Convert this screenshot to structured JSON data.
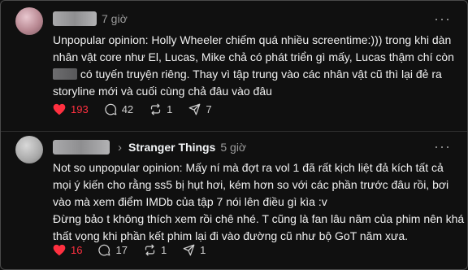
{
  "posts": [
    {
      "time": "7 giờ",
      "more": "···",
      "lines": [
        "Unpopular opinion: Holly Wheeler chiếm quá nhiều screentime:))) trong khi dàn",
        "nhân vật core như El, Lucas, Mike chả có phát triển gì mấy, Lucas thậm chí còn",
        "có tuyến truyện riêng. Thay vì tập trung vào các nhân vật cũ thì lại đẻ ra",
        "storyline mới và cuối cùng chả đâu vào đâu"
      ],
      "likes": "193",
      "comments": "42",
      "reposts": "1",
      "shares": "7"
    },
    {
      "community": "Stranger Things",
      "time": "5 giờ",
      "more": "···",
      "lines": [
        "Not so unpopular opinion: Mấy ní mà đợt ra vol 1 đã rất kịch liệt đả kích tất cả",
        "mọi ý kiến cho rằng ss5 bị hụt hơi, kém hơn so với các phần trước đâu rồi, bơi",
        "vào mà xem điểm IMDb của tập 7 nói lên điều gì kìa :v",
        "Đừng bảo t không thích xem rồi chê nhé. T cũng là fan lâu năm của phim nên khá",
        "thất vọng khi phần kết phim lại đi vào đường cũ như bộ GoT năm xưa."
      ],
      "likes": "16",
      "comments": "17",
      "reposts": "1",
      "shares": "1"
    }
  ],
  "colors": {
    "like": "#ff3040",
    "background": "#101010",
    "muted": "#9a9a9a"
  },
  "icons": [
    "heart-icon",
    "comment-icon",
    "repost-icon",
    "share-icon",
    "more-icon",
    "chevron-right-icon"
  ]
}
